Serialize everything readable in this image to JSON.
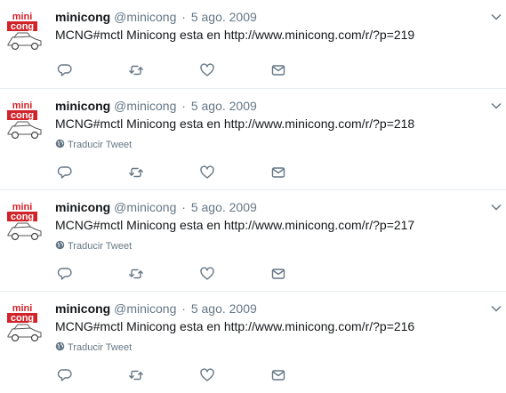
{
  "tweets": [
    {
      "fullname": "minicong",
      "handle": "@minicong",
      "separator": "·",
      "date": "5 ago. 2009",
      "text": "MCNG#mctl Minicong esta en http://www.minicong.com/r/?p=219",
      "translate_label": ""
    },
    {
      "fullname": "minicong",
      "handle": "@minicong",
      "separator": "·",
      "date": "5 ago. 2009",
      "text": "MCNG#mctl Minicong esta en http://www.minicong.com/r/?p=218",
      "translate_label": "Traducir Tweet"
    },
    {
      "fullname": "minicong",
      "handle": "@minicong",
      "separator": "·",
      "date": "5 ago. 2009",
      "text": "MCNG#mctl Minicong esta en http://www.minicong.com/r/?p=217",
      "translate_label": "Traducir Tweet"
    },
    {
      "fullname": "minicong",
      "handle": "@minicong",
      "separator": "·",
      "date": "5 ago. 2009",
      "text": "MCNG#mctl Minicong esta en http://www.minicong.com/r/?p=216",
      "translate_label": "Traducir Tweet"
    }
  ],
  "avatar": {
    "logo_line1": "mini",
    "logo_line2": "cong"
  },
  "icons": {
    "reply": "reply-icon",
    "retweet": "retweet-icon",
    "like": "heart-icon",
    "message": "envelope-icon",
    "caret": "chevron-down-icon",
    "globe": "globe-icon"
  },
  "colors": {
    "text": "#14171a",
    "muted": "#657786",
    "border": "#e6ecf0",
    "logo_red": "#d2232a"
  }
}
